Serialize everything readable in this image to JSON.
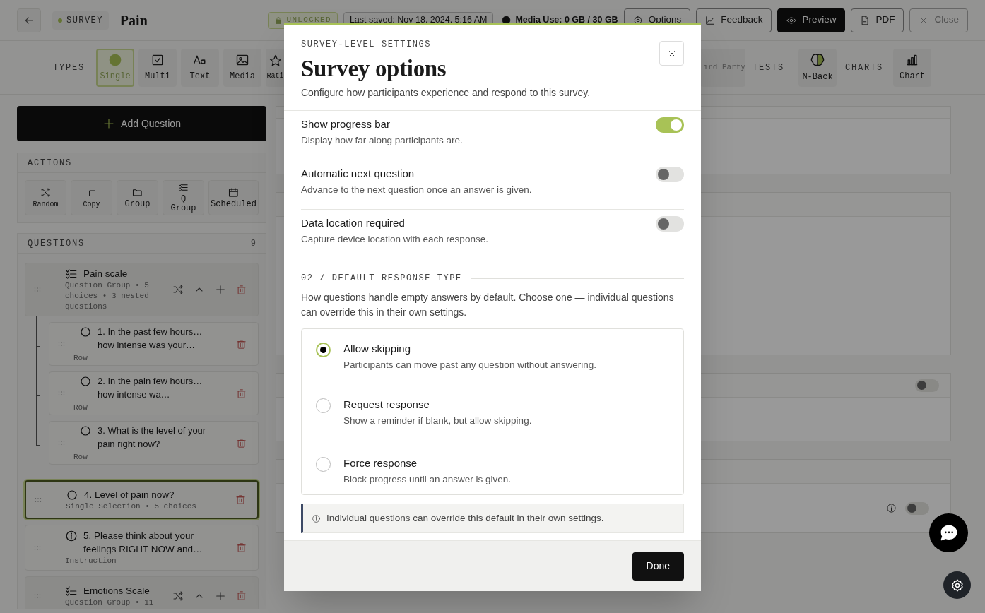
{
  "header": {
    "badge": "SURVEY",
    "title": "Pain",
    "lock_status": "UNLOCKED",
    "last_saved": "Last saved: Nov 18, 2024, 5:16 AM",
    "media_use": "Media Use: 0 GB / 30 GB",
    "buttons": [
      {
        "label": "Options",
        "kind": "outline"
      },
      {
        "label": "Feedback",
        "kind": "outline"
      },
      {
        "label": "Preview",
        "kind": "primary"
      },
      {
        "label": "PDF",
        "kind": "outline"
      },
      {
        "label": "Close",
        "kind": "muted"
      }
    ]
  },
  "toolbar": {
    "types_label": "TYPES",
    "types": [
      {
        "label": "Single",
        "selected": true
      },
      {
        "label": "Multi",
        "selected": false
      },
      {
        "label": "Text",
        "selected": false
      },
      {
        "label": "Media",
        "selected": false
      },
      {
        "label": "Rati",
        "selected": false
      }
    ],
    "partial_item": {
      "label": "ird Party",
      "disabled": true
    },
    "tests_label": "TESTS",
    "tests": [
      {
        "label": "N-Back"
      }
    ],
    "charts_label": "CHARTS",
    "charts": [
      {
        "label": "Chart"
      }
    ]
  },
  "sidebar": {
    "add_button": "Add Question",
    "actions_title": "ACTIONS",
    "actions": [
      {
        "label": "Random"
      },
      {
        "label": "Copy"
      },
      {
        "label": "Group"
      },
      {
        "label": "Q Group"
      },
      {
        "label": "Scheduled"
      }
    ],
    "questions_title": "QUESTIONS",
    "questions_count": "9",
    "questions": [
      {
        "kind": "group",
        "title": "Pain scale",
        "meta": "Question Group • 5 choices • 3 nested questions",
        "selected": false,
        "children": [
          {
            "kind": "single",
            "title": "1. In the past few hours… how intense was your…",
            "meta": "Row",
            "selected": false
          },
          {
            "kind": "single",
            "title": "2. In the pain few hours… how intense wa…",
            "meta": "Row",
            "selected": false
          },
          {
            "kind": "single",
            "title": "3. What is the level of your pain right now?",
            "meta": "Row",
            "selected": false
          }
        ]
      },
      {
        "kind": "single",
        "title": "4. Level of pain now?",
        "meta": "Single Selection • 5 choices",
        "selected": true
      },
      {
        "kind": "instruction",
        "title": "5. Please think about your feelings RIGHT NOW and…",
        "meta": "Instruction",
        "selected": false
      },
      {
        "kind": "group",
        "title": "Emotions Scale",
        "meta": "Question Group • 11",
        "selected": false
      }
    ]
  },
  "main_cards": [
    {
      "kind": "plain"
    },
    {
      "kind": "plain"
    },
    {
      "kind": "toggle",
      "on": false
    },
    {
      "kind": "toggle_info",
      "on": false
    }
  ],
  "modal": {
    "eyebrow": "SURVEY-LEVEL SETTINGS",
    "title": "Survey options",
    "subtitle": "Configure how participants experience and respond to this survey.",
    "settings": [
      {
        "title": "Show progress bar",
        "description": "Display how far along participants are.",
        "on": true
      },
      {
        "title": "Automatic next question",
        "description": "Advance to the next question once an answer is given.",
        "on": false
      },
      {
        "title": "Data location required",
        "description": "Capture device location with each response.",
        "on": false
      }
    ],
    "section_title": "02 / DEFAULT RESPONSE TYPE",
    "section_description": "How questions handle empty answers by default. Choose one — individual questions can override this in their own settings.",
    "options": [
      {
        "title": "Allow skipping",
        "description": "Participants can move past any question without answering.",
        "selected": true
      },
      {
        "title": "Request response",
        "description": "Show a reminder if blank, but allow skipping.",
        "selected": false
      },
      {
        "title": "Force response",
        "description": "Block progress until an answer is given.",
        "selected": false
      }
    ],
    "note": "Individual questions can override this default in their own settings.",
    "done_button": "Done"
  }
}
